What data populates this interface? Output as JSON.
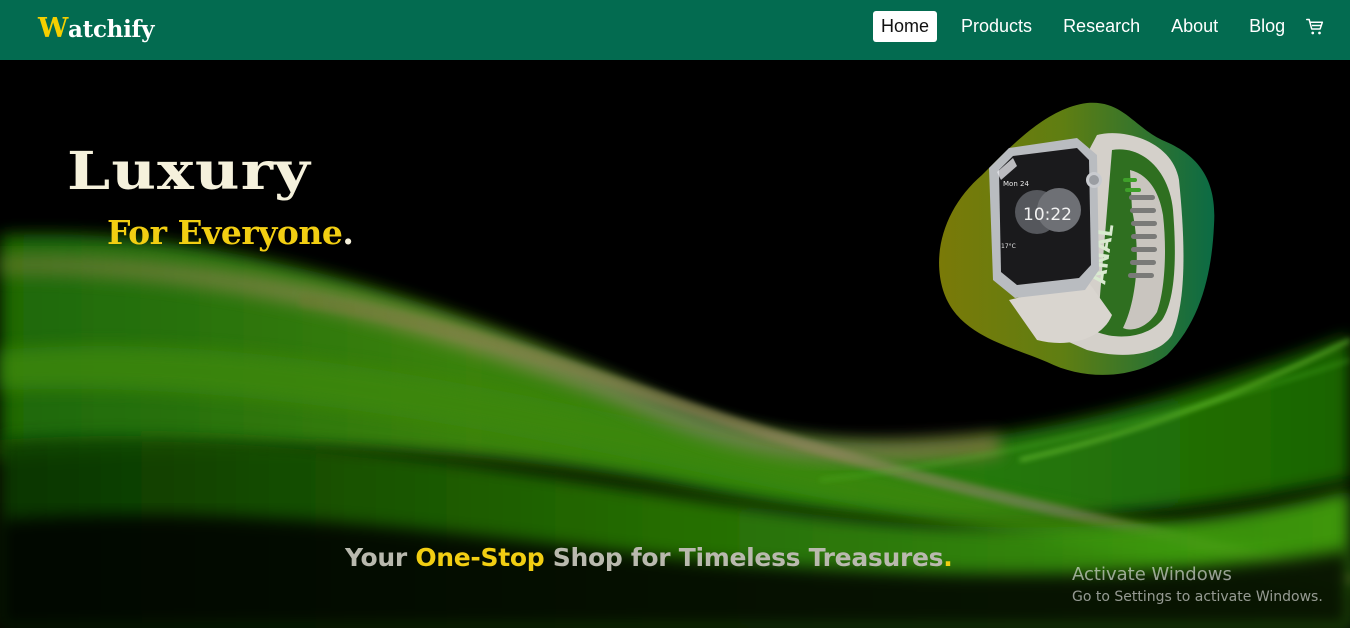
{
  "navbar": {
    "logo": {
      "first_letter": "W",
      "rest": "atchify"
    },
    "links": [
      {
        "label": "Home",
        "active": true
      },
      {
        "label": "Products",
        "active": false
      },
      {
        "label": "Research",
        "active": false
      },
      {
        "label": "About",
        "active": false
      },
      {
        "label": "Blog",
        "active": false
      }
    ],
    "cart_icon": "shopping-cart-icon",
    "background_color": "#036b50"
  },
  "hero": {
    "title": "Luxury",
    "subtitle": "For Everyone",
    "subtitle_dot": ".",
    "tagline": {
      "part1": "Your ",
      "highlight": "One-Stop",
      "part2": " Shop for Timeless Treasures",
      "dot": "."
    },
    "watch_screen": {
      "date": "Mon 24",
      "time": "10:22",
      "temp": "17°C",
      "strap_text": "ANAL"
    },
    "accent_color": "#f2ce12"
  },
  "windows_watermark": {
    "line1": "Activate Windows",
    "line2": "Go to Settings to activate Windows."
  }
}
